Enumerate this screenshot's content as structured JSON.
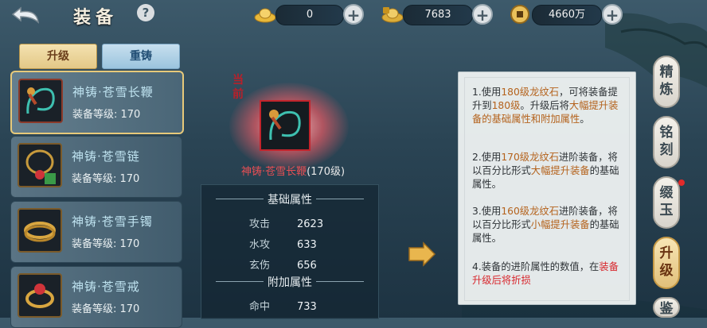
{
  "header": {
    "title": "装备",
    "help": "?"
  },
  "currencies": [
    {
      "name": "gold-ingot",
      "value": "0"
    },
    {
      "name": "bound-ingot",
      "value": "7683"
    },
    {
      "name": "coin",
      "value": "4660万"
    }
  ],
  "tabs": {
    "upgrade": "升级",
    "reforge": "重铸"
  },
  "equipment": [
    {
      "name": "神铸·苍雪长鞭",
      "level": "装备等级: 170",
      "selected": true
    },
    {
      "name": "神铸·苍雪链",
      "level": "装备等级: 170",
      "selected": false
    },
    {
      "name": "神铸·苍雪手镯",
      "level": "装备等级: 170",
      "selected": false
    },
    {
      "name": "神铸·苍雪戒",
      "level": "装备等级: 170",
      "selected": false
    }
  ],
  "preview": {
    "current_tag": "当前",
    "name": "神铸·苍雪长鞭",
    "level_suffix": "(170级)"
  },
  "stats": {
    "base_title": "基础属性",
    "base": [
      {
        "k": "攻击",
        "v": "2623"
      },
      {
        "k": "水攻",
        "v": "633"
      },
      {
        "k": "玄伤",
        "v": "656"
      }
    ],
    "extra_title": "附加属性",
    "extra": [
      {
        "k": "命中",
        "v": "733"
      }
    ]
  },
  "info": {
    "p1a": "1.使用",
    "p1b": "180级龙纹石",
    "p1c": "，可将装备提升到",
    "p1d": "180级",
    "p1e": "。升级后将",
    "p1f": "大幅提升装备的基础属性和附加属性",
    "p1g": "。",
    "p2a": "2.使用",
    "p2b": "170级龙纹石",
    "p2c": "进阶装备，将以百分比形式",
    "p2d": "大幅提升装备",
    "p2e": "的基础属性。",
    "p3a": "3.使用",
    "p3b": "160级龙纹石",
    "p3c": "进阶装备，将以百分比形式",
    "p3d": "小幅提升装备",
    "p3e": "的基础属性。",
    "p4a": "4.装备的进阶属性的数值，在",
    "p4b": "装备升级后将折损"
  },
  "side_tabs": [
    {
      "label": "精炼",
      "active": false
    },
    {
      "label": "铭刻",
      "active": false
    },
    {
      "label": "缀玉",
      "active": false
    },
    {
      "label": "升级",
      "active": true
    },
    {
      "label": "鉴",
      "active": false
    }
  ],
  "colors": {
    "accent_gold": "#e7c97a",
    "highlight_red": "#d8262c",
    "highlight_orange": "#b4621c"
  }
}
